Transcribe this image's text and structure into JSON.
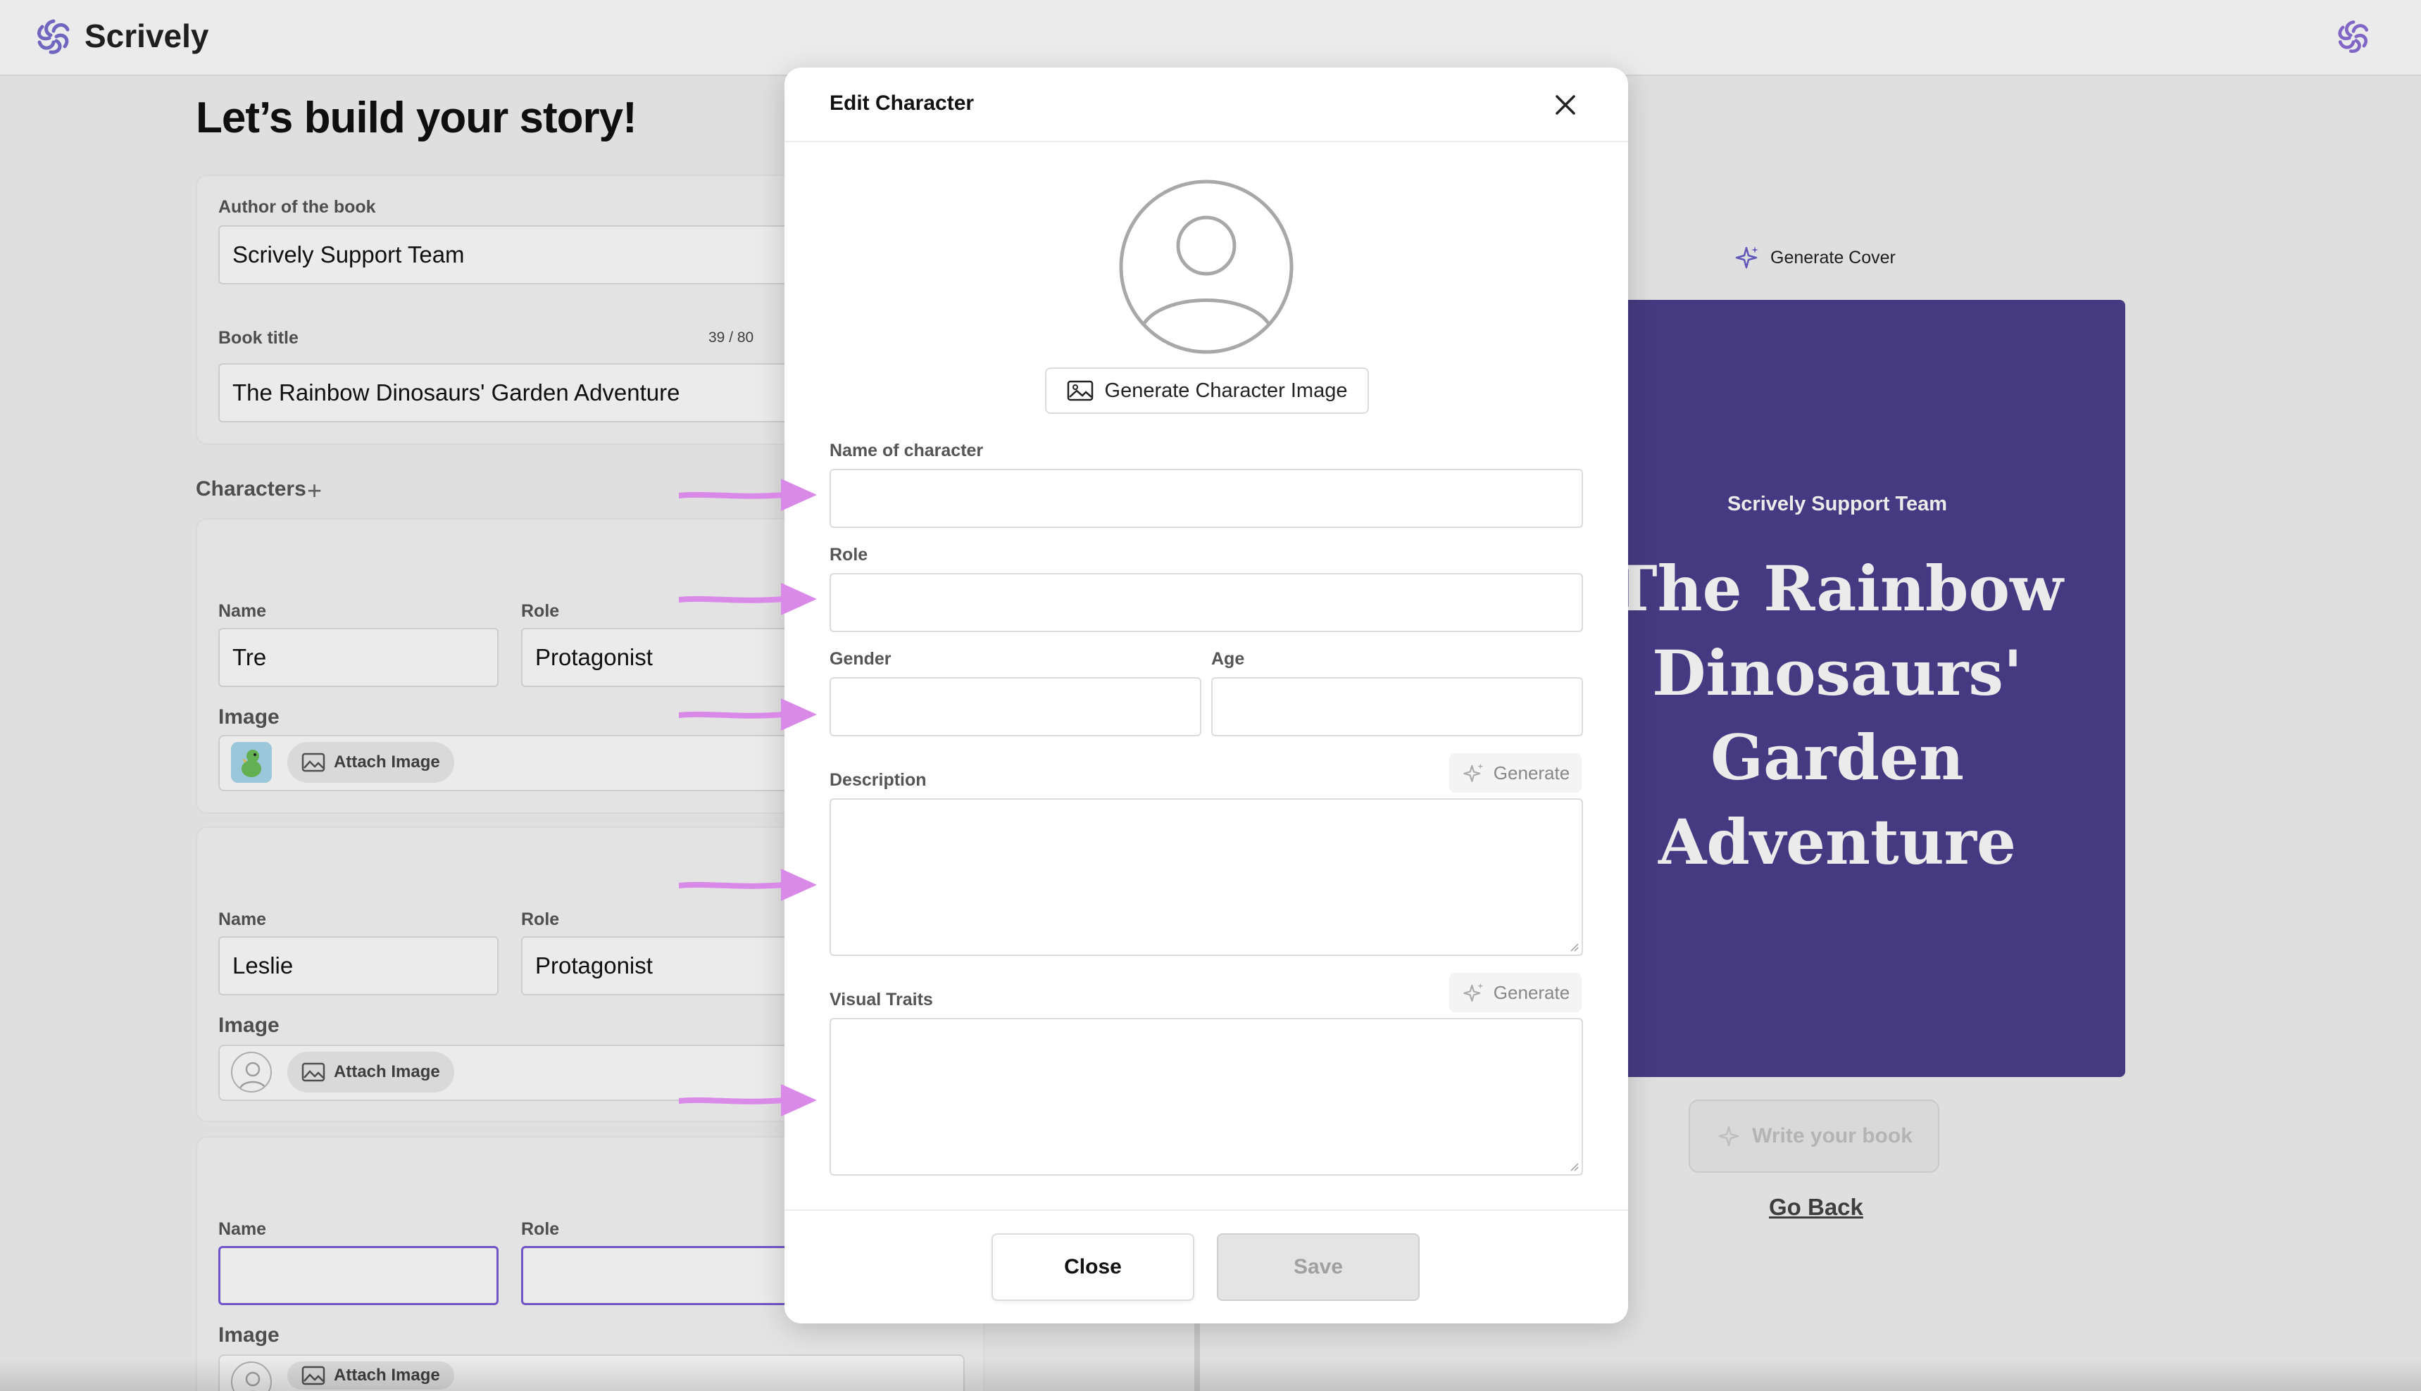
{
  "app": {
    "brand": "Scrively"
  },
  "page": {
    "title": "Let’s build your story!"
  },
  "form": {
    "author_label": "Author of the book",
    "author_value": "Scrively Support Team",
    "title_label": "Book title",
    "title_counter": "39 / 80",
    "title_value": "The Rainbow Dinosaurs' Garden Adventure"
  },
  "characters": {
    "heading": "Characters",
    "add_symbol": "+",
    "name_label": "Name",
    "role_label": "Role",
    "image_label": "Image",
    "attach_label": "Attach Image",
    "items": [
      {
        "name": "Tre",
        "role": "Protagonist"
      },
      {
        "name": "Leslie",
        "role": "Protagonist"
      },
      {
        "name": "",
        "role": ""
      }
    ]
  },
  "preview": {
    "generate_cover": "Generate Cover",
    "cover_author": "Scrively Support Team",
    "cover_title": "The Rainbow Dinosaurs' Garden Adventure",
    "cover_color": "#4b3f8c",
    "write_button": "Write your book",
    "go_back": "Go Back"
  },
  "modal": {
    "title": "Edit Character",
    "generate_image": "Generate Character Image",
    "name_label": "Name of character",
    "name_value": "",
    "role_label": "Role",
    "role_value": "",
    "gender_label": "Gender",
    "gender_value": "",
    "age_label": "Age",
    "age_value": "",
    "description_label": "Description",
    "description_value": "",
    "visual_traits_label": "Visual Traits",
    "visual_traits_value": "",
    "generate_label": "Generate",
    "close_button": "Close",
    "save_button": "Save"
  },
  "colors": {
    "accent": "#7b5cd6",
    "annotation_arrow": "#d98ae8"
  }
}
